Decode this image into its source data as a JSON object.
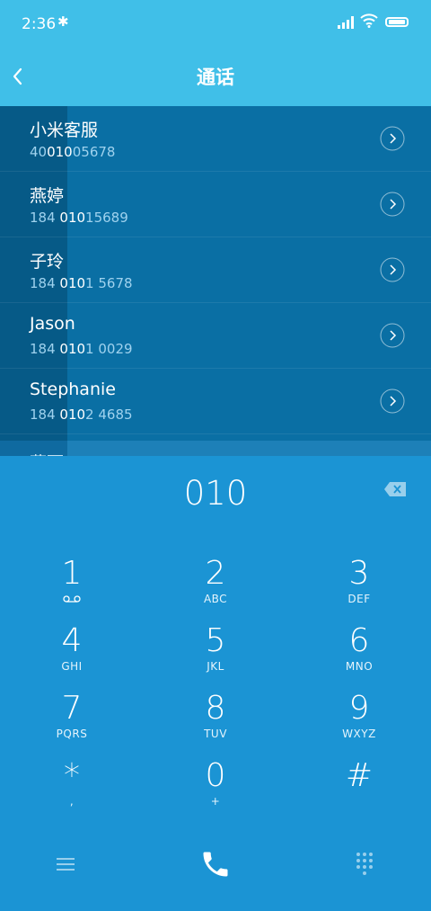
{
  "status_bar": {
    "time": "2:36",
    "bluetooth_icon": "bluetooth-icon",
    "signal_icon": "signal-icon",
    "wifi_icon": "wifi-icon",
    "battery_icon": "battery-icon"
  },
  "header": {
    "title": "通话",
    "back_icon": "back-arrow-icon"
  },
  "results": [
    {
      "name": "小米客服",
      "num_pre": "40",
      "num_match": "010",
      "num_post": "05678"
    },
    {
      "name": "燕婷",
      "num_pre": "184 ",
      "num_match": "010",
      "num_post": "15689"
    },
    {
      "name": "子玲",
      "num_pre": "184 ",
      "num_match": "010",
      "num_post": "1 5678"
    },
    {
      "name": "Jason",
      "num_pre": "184 ",
      "num_match": "010",
      "num_post": "1 0029"
    },
    {
      "name": "Stephanie",
      "num_pre": "184 ",
      "num_match": "010",
      "num_post": "2 4685"
    }
  ],
  "partial_row": {
    "name": "燕丽"
  },
  "dialer": {
    "input": "010",
    "keys": [
      {
        "digit": "1",
        "letters": ""
      },
      {
        "digit": "2",
        "letters": "ABC"
      },
      {
        "digit": "3",
        "letters": "DEF"
      },
      {
        "digit": "4",
        "letters": "GHI"
      },
      {
        "digit": "5",
        "letters": "JKL"
      },
      {
        "digit": "6",
        "letters": "MNO"
      },
      {
        "digit": "7",
        "letters": "PQRS"
      },
      {
        "digit": "8",
        "letters": "TUV"
      },
      {
        "digit": "9",
        "letters": "WXYZ"
      },
      {
        "digit": "*",
        "letters": ","
      },
      {
        "digit": "0",
        "letters": "+"
      },
      {
        "digit": "#",
        "letters": ""
      }
    ]
  },
  "colors": {
    "header": "#40bfe8",
    "list_bg": "#0a6fa4",
    "dialer_bg": "#1b94d4"
  }
}
